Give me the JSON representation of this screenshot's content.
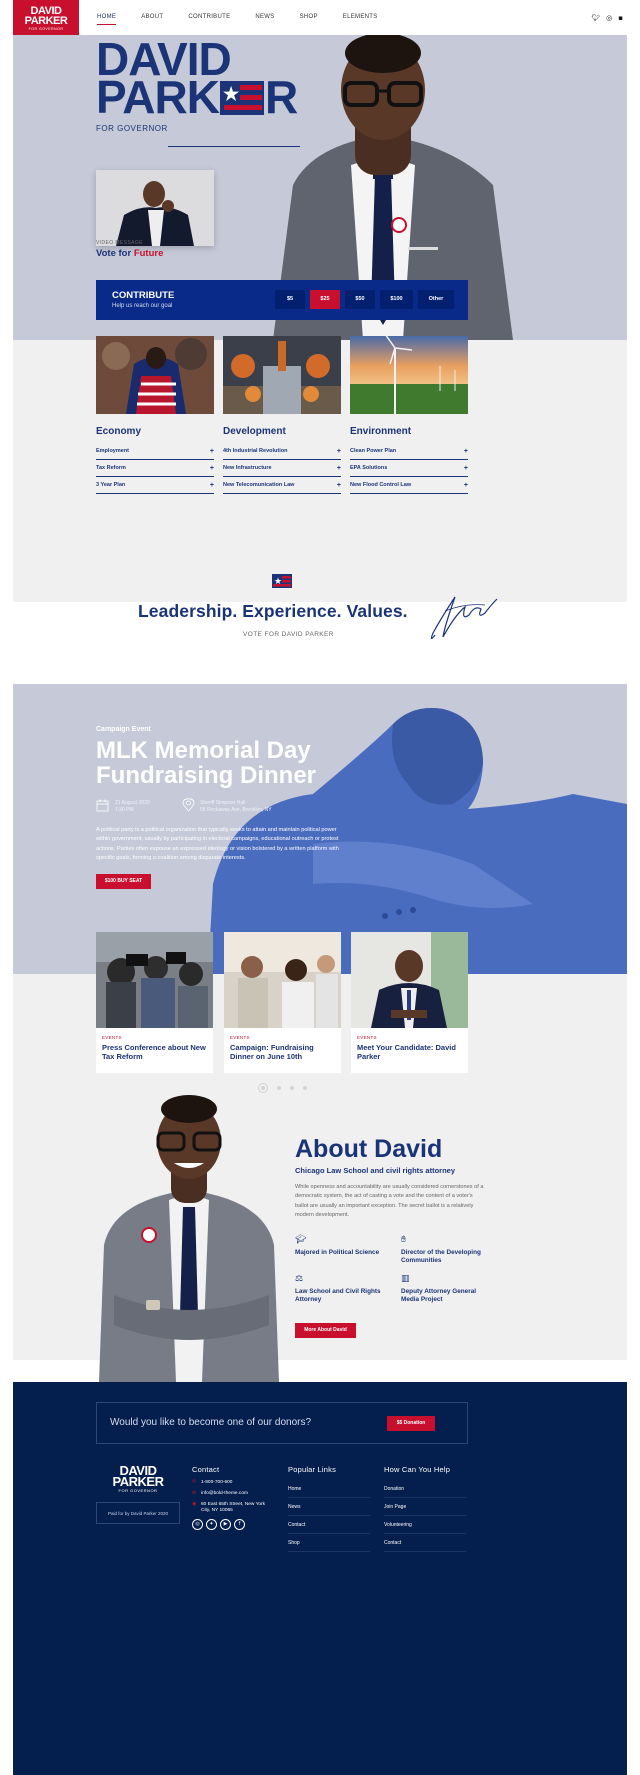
{
  "header": {
    "logo": {
      "line1": "DAVID",
      "line2": "PARKER",
      "line3": "FOR GOVERNOR"
    },
    "nav": [
      "HOME",
      "ABOUT",
      "CONTRIBUTE",
      "NEWS",
      "SHOP",
      "ELEMENTS"
    ],
    "active_nav": "HOME",
    "social_icons": [
      "twitter-icon",
      "instagram-icon",
      "facebook-icon"
    ]
  },
  "hero": {
    "name_line1": "DAVID",
    "name_line2_a": "PARK",
    "name_line2_b": "R",
    "subtitle": "FOR GOVERNOR",
    "video_label": "VIDEO MESSAGE",
    "video_title_a": "Vote for",
    "video_title_b": "Future"
  },
  "contribute": {
    "title": "CONTRIBUTE",
    "subtitle": "Help us reach our goal",
    "amounts": [
      "$5",
      "$25",
      "$50",
      "$100",
      "Other"
    ],
    "selected": "$25"
  },
  "policies": [
    {
      "title": "Economy",
      "items": [
        "Employment",
        "Tax Reform",
        "3 Year Plan"
      ]
    },
    {
      "title": "Development",
      "items": [
        "4th Industrial Revolution",
        "New Infrastructure",
        "New Telecomunication Law"
      ]
    },
    {
      "title": "Environment",
      "items": [
        "Clean Power Plan",
        "EPA Solutions",
        "New Flood Control Law"
      ]
    }
  ],
  "leadership": {
    "headline": "Leadership. Experience. Values.",
    "tagline": "VOTE FOR DAVID PARKER"
  },
  "event": {
    "kicker": "Campaign Event",
    "title": "MLK Memorial Day Fundraising Dinner",
    "date_line1": "21 August 2020",
    "date_line2": "7:30 PM",
    "place_line1": "Sheriff Simpson Hall",
    "place_line2": "58 Rockaway Ave, Brooklyn, NY",
    "description": "A political party is a political organization that typically seeks to attain and maintain political power within government, usually by participating in electoral campaigns, educational outreach or protest actions. Parties often espouse an expressed ideology or vision bolstered by a written platform with specific goals, forming a coalition among disparate interests.",
    "button": "$100 BUY SEAT"
  },
  "news": [
    {
      "kicker": "EVENTS",
      "title": "Press Conference about New Tax Reform"
    },
    {
      "kicker": "EVENTS",
      "title": "Campaign: Fundraising Dinner on June 10th"
    },
    {
      "kicker": "EVENTS",
      "title": "Meet Your Candidate: David Parker"
    }
  ],
  "about": {
    "title": "About David",
    "subtitle": "Chicago Law School and civil rights attorney",
    "description": "While openness and accountability are usually considered cornerstones of a democratic system, the act of casting a vote and the content of a voter's ballot are usually an important exception. The secret ballot is a relatively modern development.",
    "features": [
      {
        "icon": "graduation-cap-icon",
        "text": "Majored in Political Science"
      },
      {
        "icon": "handshake-icon",
        "text": "Director of the Developing Communities"
      },
      {
        "icon": "scales-icon",
        "text": "Law School and Civil Rights Attorney"
      },
      {
        "icon": "podium-icon",
        "text": "Deputy Attorney General Media Project"
      }
    ],
    "button": "More About David"
  },
  "footer": {
    "donor_question": "Would you like to become one of our donors?",
    "donor_button": "$5 Donation",
    "logo_line1": "DAVID",
    "logo_line2": "PARKER",
    "logo_line3": "FOR GOVERNOR",
    "paid_by": "Paid for by David Parker 2020",
    "contact_title": "Contact",
    "phone": "1-800-700-600",
    "email": "info@bold-theme.com",
    "address_line1": "60 East 65th Street, New York",
    "address_line2": "City, NY 10065",
    "links_title": "Popular Links",
    "links": [
      "Home",
      "News",
      "Contact",
      "Shop"
    ],
    "help_title": "How Can You Help",
    "help": [
      "Donation",
      "Join Page",
      "Volunteering",
      "Contact"
    ]
  },
  "colors": {
    "brand_red": "#c8102e",
    "brand_navy": "#1b3478",
    "footer_navy": "#041e4d",
    "contribute_blue": "#0a2a8a"
  }
}
